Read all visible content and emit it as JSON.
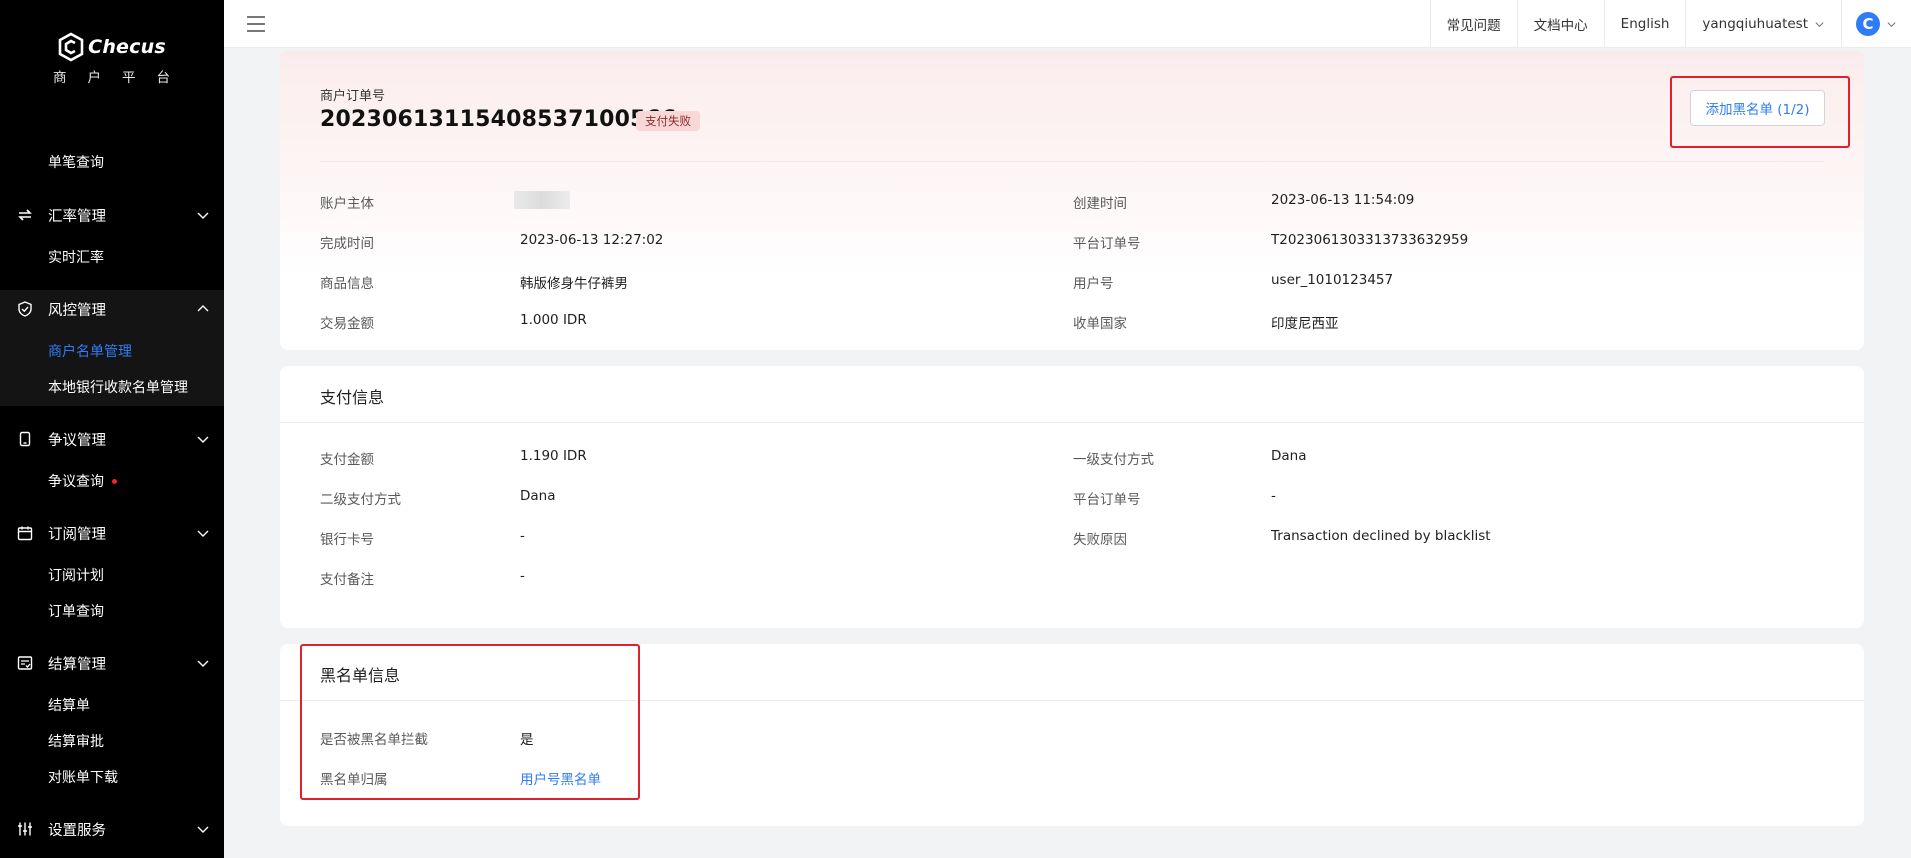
{
  "brand": {
    "name": "Checus",
    "subtitle": "商户平台"
  },
  "sidebar": {
    "groups": [
      {
        "label": "汇率管理",
        "icon": "exchange-icon"
      },
      {
        "label": "风控管理",
        "icon": "shield-icon"
      },
      {
        "label": "争议管理",
        "icon": "phone-icon"
      },
      {
        "label": "订阅管理",
        "icon": "calendar-icon"
      },
      {
        "label": "结算管理",
        "icon": "checklist-icon"
      },
      {
        "label": "设置服务",
        "icon": "sliders-icon"
      }
    ],
    "items": [
      {
        "label": "单笔查询"
      },
      {
        "label": "实时汇率"
      },
      {
        "label": "商户名单管理"
      },
      {
        "label": "本地银行收款名单管理"
      },
      {
        "label": "争议查询"
      },
      {
        "label": "订阅计划"
      },
      {
        "label": "订单查询"
      },
      {
        "label": "结算单"
      },
      {
        "label": "结算审批"
      },
      {
        "label": "对账单下载"
      }
    ]
  },
  "header": {
    "faq": "常见问题",
    "docs": "文档中心",
    "language": "English",
    "username": "yangqiuhuatest",
    "avatar_letter": "C"
  },
  "order": {
    "label": "商户订单号",
    "number": "20230613115408537100566",
    "status": "支付失败",
    "add_blacklist_button": "添加黑名单 (1/2)",
    "fields": {
      "account_subject_label": "账户主体",
      "created_time_label": "创建时间",
      "created_time": "2023-06-13 11:54:09",
      "completed_time_label": "完成时间",
      "completed_time": "2023-06-13 12:27:02",
      "platform_order_label": "平台订单号",
      "platform_order": "T2023061303313733632959",
      "product_label": "商品信息",
      "product": "韩版修身牛仔裤男",
      "user_id_label": "用户号",
      "user_id": "user_1010123457",
      "amount_label": "交易金额",
      "amount": "1.000 IDR",
      "country_label": "收单国家",
      "country": "印度尼西亚"
    }
  },
  "payment": {
    "title": "支付信息",
    "pay_amount_label": "支付金额",
    "pay_amount": "1.190 IDR",
    "method1_label": "一级支付方式",
    "method1": "Dana",
    "method2_label": "二级支付方式",
    "method2": "Dana",
    "platform_order_label": "平台订单号",
    "platform_order": "-",
    "bank_card_label": "银行卡号",
    "bank_card": "-",
    "fail_reason_label": "失败原因",
    "fail_reason": "Transaction declined by blacklist",
    "remark_label": "支付备注",
    "remark": "-"
  },
  "blacklist": {
    "title": "黑名单信息",
    "blocked_label": "是否被黑名单拦截",
    "blocked": "是",
    "belong_label": "黑名单归属",
    "belong": "用户号黑名单"
  },
  "colors": {
    "accent": "#2f7cf6",
    "highlight": "#e0202a",
    "status_bg": "#f8d7d7"
  }
}
